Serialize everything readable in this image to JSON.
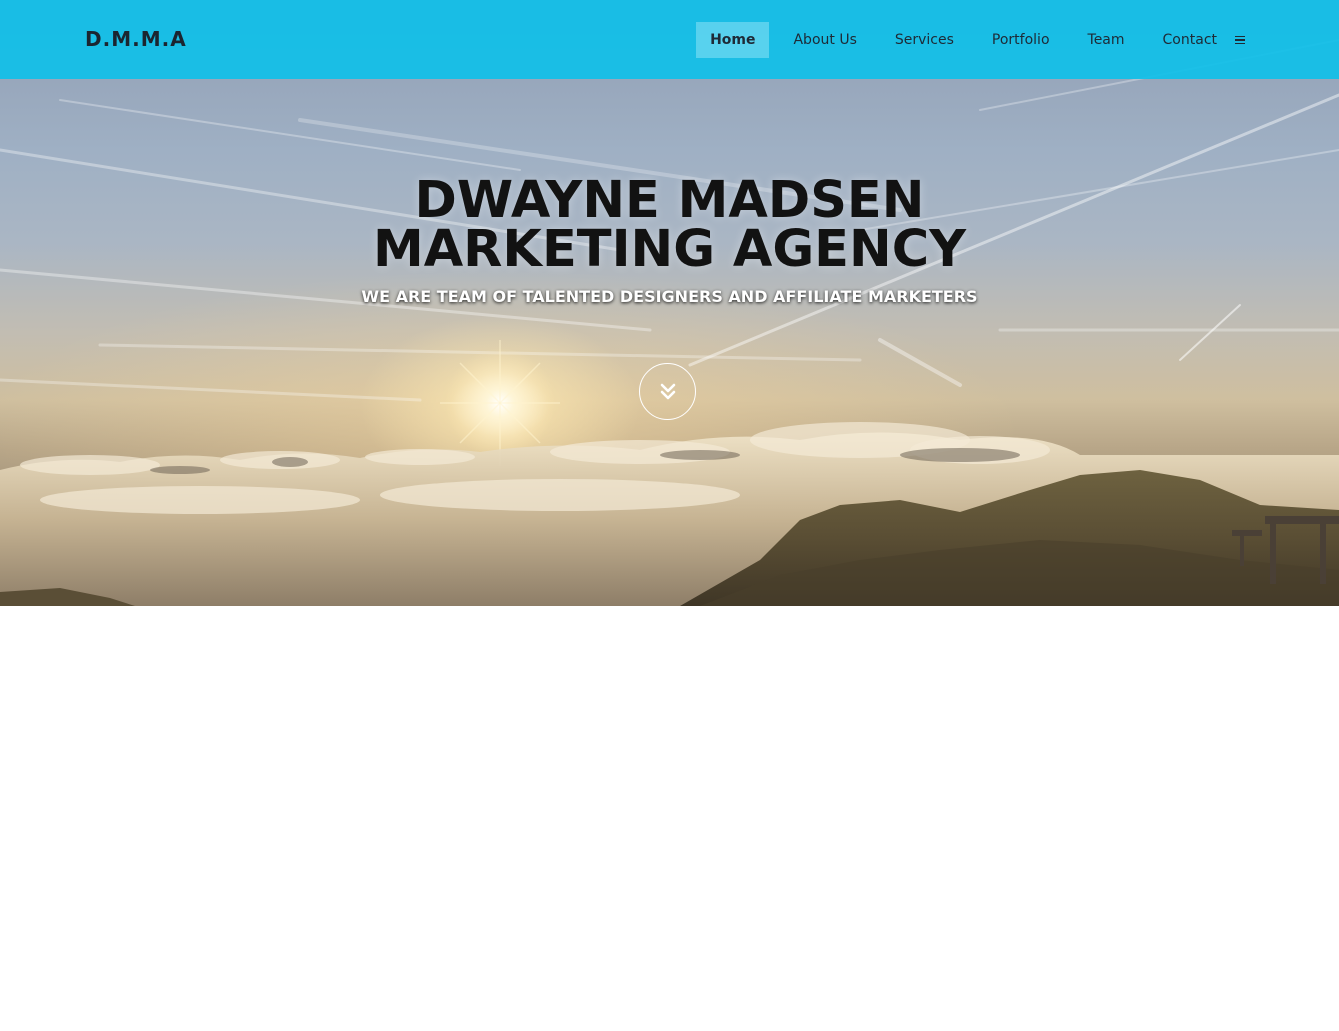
{
  "brand": {
    "name": "D.M.M.A"
  },
  "nav": {
    "items": [
      {
        "label": "Home",
        "active": true
      },
      {
        "label": "About Us",
        "active": false
      },
      {
        "label": "Services",
        "active": false
      },
      {
        "label": "Portfolio",
        "active": false
      },
      {
        "label": "Team",
        "active": false
      },
      {
        "label": "Contact",
        "active": false
      }
    ],
    "menu_icon": "hamburger-icon"
  },
  "hero": {
    "title_line1": "DWAYNE MADSEN",
    "title_line2": "MARKETING AGENCY",
    "subtitle": "WE ARE TEAM OF TALENTED DESIGNERS AND AFFILIATE MARKETERS",
    "scroll_icon": "double-chevron-down-icon"
  },
  "colors": {
    "navbar_bg": "#10c0e8",
    "nav_text": "#1e2a36",
    "title_text": "#121212",
    "subtitle_text": "#ffffff"
  }
}
